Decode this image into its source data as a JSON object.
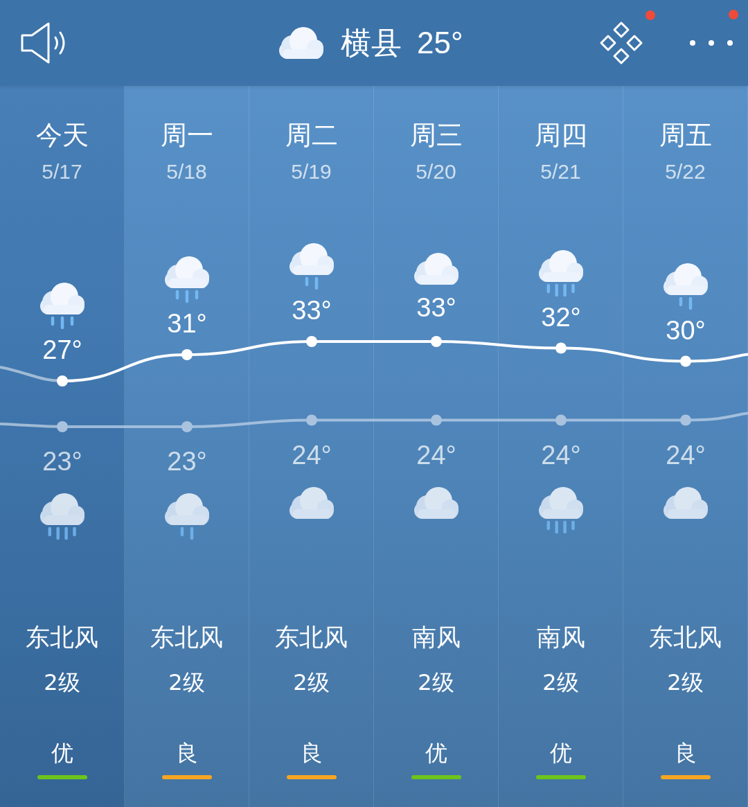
{
  "header": {
    "city": "横县",
    "temperature": "25°",
    "actions": [
      {
        "kind": "apps",
        "badge": true
      },
      {
        "kind": "more",
        "badge": true
      }
    ]
  },
  "days": [
    {
      "name": "今天",
      "date": "5/17",
      "selected": true,
      "day_icon": {
        "kind": "moderate_rain"
      },
      "high": "27°",
      "low": "23°",
      "night_icon": {
        "kind": "heavy_rain"
      },
      "wind": "东北风",
      "wind_level": "2级",
      "aqi": "优",
      "color": "#6cc41c"
    },
    {
      "name": "周一",
      "date": "5/18",
      "selected": false,
      "day_icon": {
        "kind": "moderate_rain"
      },
      "high": "31°",
      "low": "23°",
      "night_icon": {
        "kind": "light_rain"
      },
      "wind": "东北风",
      "wind_level": "2级",
      "aqi": "良",
      "color": "#f5a623"
    },
    {
      "name": "周二",
      "date": "5/19",
      "selected": false,
      "day_icon": {
        "kind": "light_rain"
      },
      "high": "33°",
      "low": "24°",
      "night_icon": {
        "kind": "cloudy"
      },
      "wind": "东北风",
      "wind_level": "2级",
      "aqi": "良",
      "color": "#f5a623"
    },
    {
      "name": "周三",
      "date": "5/20",
      "selected": false,
      "day_icon": {
        "kind": "cloudy"
      },
      "high": "33°",
      "low": "24°",
      "night_icon": {
        "kind": "cloudy"
      },
      "wind": "南风",
      "wind_level": "2级",
      "aqi": "优",
      "color": "#6cc41c"
    },
    {
      "name": "周四",
      "date": "5/21",
      "selected": false,
      "day_icon": {
        "kind": "heavy_rain"
      },
      "high": "32°",
      "low": "24°",
      "night_icon": {
        "kind": "heavy_rain"
      },
      "wind": "南风",
      "wind_level": "2级",
      "aqi": "优",
      "color": "#6cc41c"
    },
    {
      "name": "周五",
      "date": "5/22",
      "selected": false,
      "day_icon": {
        "kind": "light_rain"
      },
      "high": "30°",
      "low": "24°",
      "night_icon": {
        "kind": "cloudy"
      },
      "wind": "东北风",
      "wind_level": "2级",
      "aqi": "良",
      "color": "#f5a623"
    }
  ]
}
